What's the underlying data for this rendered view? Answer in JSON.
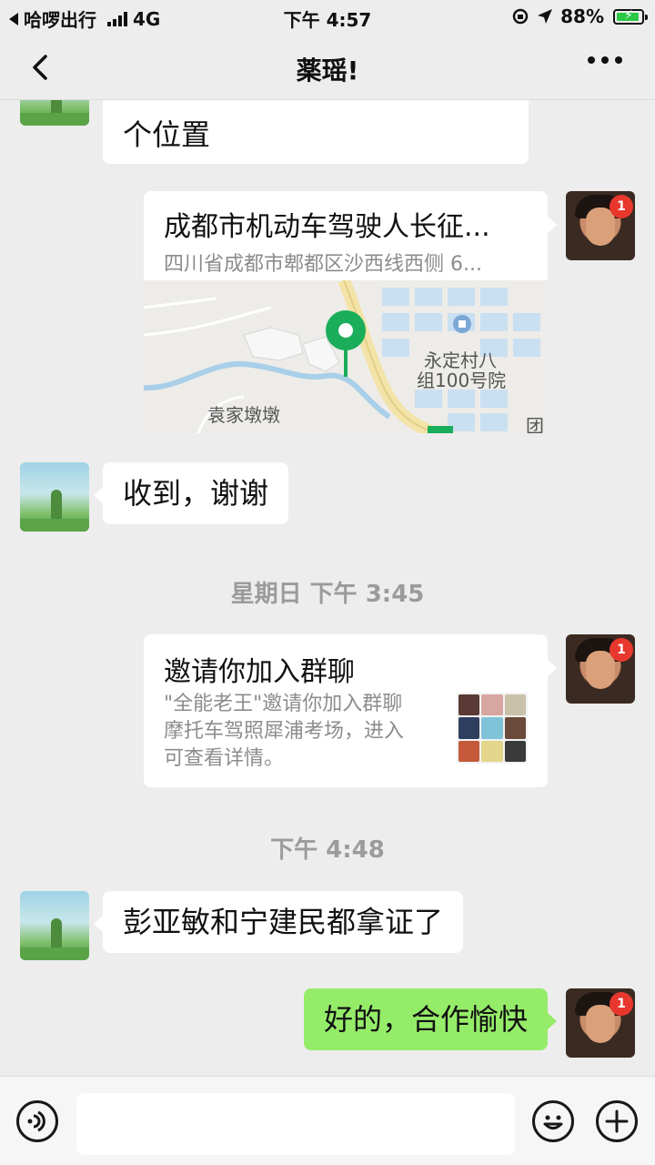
{
  "status_bar": {
    "back_app": "哈啰出行",
    "network": "4G",
    "time": "下午 4:57",
    "battery": "88%"
  },
  "nav": {
    "title": "薬瑶!",
    "back_icon": "chevron-left-icon",
    "more_icon": "more-dots-icon"
  },
  "messages": [
    {
      "side": "left",
      "type": "text",
      "text": "个位置"
    },
    {
      "side": "right",
      "type": "location",
      "title": "成都市机动车驾驶人长征...",
      "address": "四川省成都市郫都区沙西线西侧 6...",
      "map_labels": [
        "永定村八",
        "组100号院",
        "袁家墩墩",
        "团"
      ]
    },
    {
      "side": "left",
      "type": "text",
      "text": "收到，谢谢"
    },
    {
      "type": "timestamp",
      "text": "星期日 下午 3:45"
    },
    {
      "side": "right",
      "type": "invite",
      "title": "邀请你加入群聊",
      "desc_lines": [
        "\"全能老王\"邀请你加入群聊",
        "摩托车驾照犀浦考场，进入",
        "可查看详情。"
      ]
    },
    {
      "type": "timestamp",
      "text": "下午 4:48"
    },
    {
      "side": "left",
      "type": "text",
      "text": "彭亚敏和宁建民都拿证了"
    },
    {
      "side": "right",
      "type": "text",
      "text": "好的，合作愉快"
    }
  ],
  "badge_count": "1",
  "colors": {
    "green_bubble": "#95ec69",
    "badge": "#e8382e",
    "map_pin": "#1aad5a"
  },
  "input_bar": {
    "voice_icon": "voice-icon",
    "emoji_icon": "emoji-icon",
    "plus_icon": "plus-icon"
  }
}
